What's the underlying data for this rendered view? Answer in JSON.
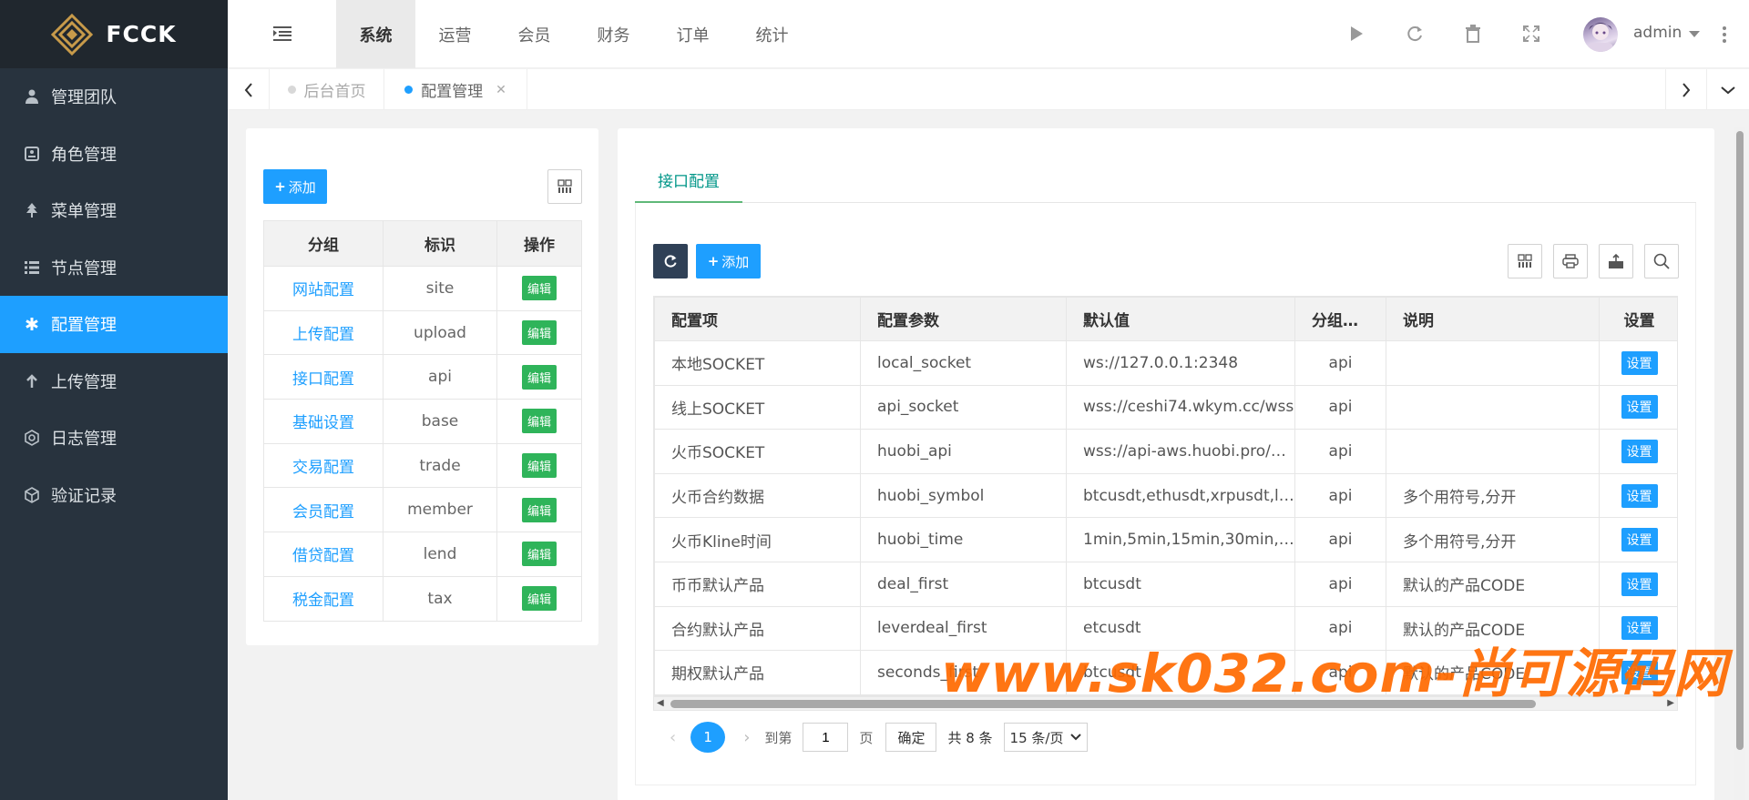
{
  "app": {
    "logo_text": "FCCK"
  },
  "sidebar": {
    "items": [
      {
        "label": "管理团队",
        "icon": "user-icon",
        "active": false
      },
      {
        "label": "角色管理",
        "icon": "id-card-icon",
        "active": false
      },
      {
        "label": "菜单管理",
        "icon": "tree-icon",
        "active": false
      },
      {
        "label": "节点管理",
        "icon": "list-icon",
        "active": false
      },
      {
        "label": "配置管理",
        "icon": "asterisk-icon",
        "active": true
      },
      {
        "label": "上传管理",
        "icon": "arrow-up-icon",
        "active": false
      },
      {
        "label": "日志管理",
        "icon": "gear-outline-icon",
        "active": false
      },
      {
        "label": "验证记录",
        "icon": "cube-icon",
        "active": false
      }
    ]
  },
  "header": {
    "topnav": [
      "系统",
      "运营",
      "会员",
      "财务",
      "订单",
      "统计"
    ],
    "active_topnav": "系统",
    "user": "admin"
  },
  "tabs": {
    "items": [
      {
        "label": "后台首页",
        "active": false
      },
      {
        "label": "配置管理",
        "active": true
      }
    ]
  },
  "left_panel": {
    "add_label": "添加",
    "columns": [
      "分组",
      "标识",
      "操作"
    ],
    "rows": [
      {
        "group": "网站配置",
        "key": "site"
      },
      {
        "group": "上传配置",
        "key": "upload"
      },
      {
        "group": "接口配置",
        "key": "api"
      },
      {
        "group": "基础设置",
        "key": "base"
      },
      {
        "group": "交易配置",
        "key": "trade"
      },
      {
        "group": "会员配置",
        "key": "member"
      },
      {
        "group": "借贷配置",
        "key": "lend"
      },
      {
        "group": "税金配置",
        "key": "tax"
      }
    ],
    "edit_label": "编辑"
  },
  "right_panel": {
    "tab_label": "接口配置",
    "add_label": "添加",
    "columns": [
      "配置项",
      "配置参数",
      "默认值",
      "分组…",
      "说明",
      "设置"
    ],
    "rows": [
      {
        "item": "本地SOCKET",
        "param": "local_socket",
        "value": "ws://127.0.0.1:2348",
        "group": "api",
        "desc": ""
      },
      {
        "item": "线上SOCKET",
        "param": "api_socket",
        "value": "wss://ceshi74.wkym.cc/wss",
        "group": "api",
        "desc": ""
      },
      {
        "item": "火币SOCKET",
        "param": "huobi_api",
        "value": "wss://api-aws.huobi.pro/…",
        "group": "api",
        "desc": ""
      },
      {
        "item": "火币合约数据",
        "param": "huobi_symbol",
        "value": "btcusdt,ethusdt,xrpusdt,lt…",
        "group": "api",
        "desc": "多个用符号,分开"
      },
      {
        "item": "火币Kline时间",
        "param": "huobi_time",
        "value": "1min,5min,15min,30min,…",
        "group": "api",
        "desc": "多个用符号,分开"
      },
      {
        "item": "币币默认产品",
        "param": "deal_first",
        "value": "btcusdt",
        "group": "api",
        "desc": "默认的产品CODE"
      },
      {
        "item": "合约默认产品",
        "param": "leverdeal_first",
        "value": "etcusdt",
        "group": "api",
        "desc": "默认的产品CODE"
      },
      {
        "item": "期权默认产品",
        "param": "seconds_first",
        "value": "btcusdt",
        "group": "api",
        "desc": "默认的产品CODE"
      }
    ],
    "set_label": "设置",
    "pager": {
      "current_page": "1",
      "goto_prefix": "到第",
      "goto_value": "1",
      "goto_suffix": "页",
      "confirm_label": "确定",
      "total": "共 8 条",
      "page_size": "15 条/页"
    }
  },
  "watermark": "www.sk032.com-尚可源码网",
  "colors": {
    "primary": "#1e9fff",
    "sidebar_bg": "#28333e",
    "edit_green": "#2fb45a",
    "tab_teal": "#009688"
  }
}
